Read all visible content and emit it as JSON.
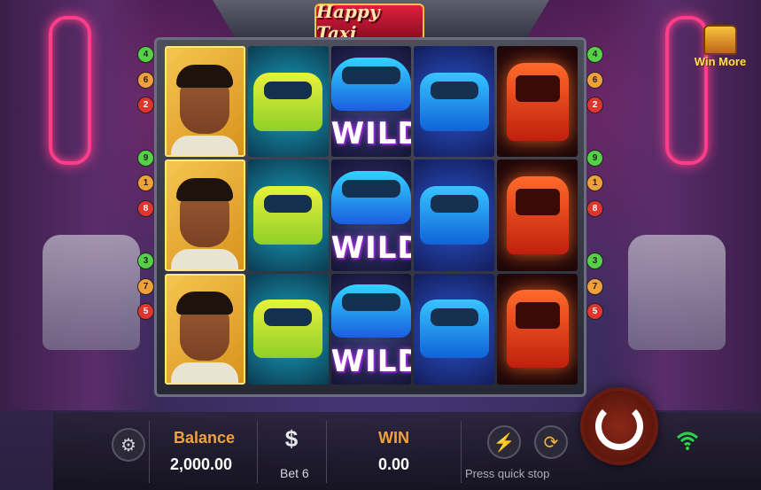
{
  "game": {
    "logo": "Happy Taxi"
  },
  "reels": [
    [
      "man",
      "man",
      "man"
    ],
    [
      "taxi-yellow",
      "taxi-yellow",
      "taxi-yellow"
    ],
    [
      "wild",
      "wild",
      "wild"
    ],
    [
      "taxi-blue",
      "taxi-blue",
      "taxi-blue"
    ],
    [
      "tuk",
      "tuk",
      "tuk"
    ]
  ],
  "wild_label": "WILD",
  "paylines": {
    "left": [
      {
        "n": "4",
        "c": "green"
      },
      {
        "n": "6",
        "c": "orange"
      },
      {
        "n": "2",
        "c": "red"
      },
      {
        "n": "9",
        "c": "green"
      },
      {
        "n": "1",
        "c": "orange"
      },
      {
        "n": "8",
        "c": "red"
      },
      {
        "n": "3",
        "c": "green"
      },
      {
        "n": "7",
        "c": "orange"
      },
      {
        "n": "5",
        "c": "red"
      }
    ],
    "right": [
      {
        "n": "4",
        "c": "green"
      },
      {
        "n": "6",
        "c": "orange"
      },
      {
        "n": "2",
        "c": "red"
      },
      {
        "n": "9",
        "c": "green"
      },
      {
        "n": "1",
        "c": "orange"
      },
      {
        "n": "8",
        "c": "red"
      },
      {
        "n": "3",
        "c": "green"
      },
      {
        "n": "7",
        "c": "orange"
      },
      {
        "n": "5",
        "c": "red"
      }
    ]
  },
  "win_more": {
    "label": "Win More",
    "icon": "treasure-chest-icon"
  },
  "bottom": {
    "balance_label": "Balance",
    "balance_value": "2,000.00",
    "bet_icon": "dollar-icon",
    "bet_label": "Bet 6",
    "win_label": "WIN",
    "win_value": "0.00",
    "quick_stop_label": "Press quick stop",
    "settings_icon": "gear-icon",
    "turbo_icon": "lightning-icon",
    "autoplay_icon": "autoplay-icon",
    "spin_icon": "spin-arrow-icon",
    "signal_icon": "wifi-icon"
  },
  "colors": {
    "accent": "#f2a23a",
    "wifi": "#2ed14a"
  }
}
